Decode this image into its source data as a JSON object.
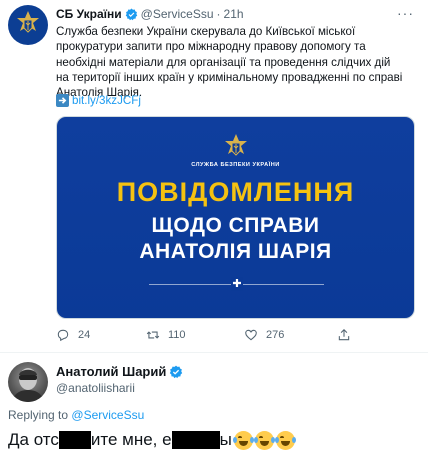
{
  "tweet": {
    "author_name": "СБ України",
    "author_handle": "@ServiceSsu",
    "separator": "·",
    "time": "21h",
    "more": "···",
    "text": "Служба безпеки України скерувала до Київської міської прокуратури запити про міжнародну правову допомогу та необхідні матеріали для організації та проведення слідчих дій на території інших країн у кримінальному провадженні по справі Анатолія Шарія.",
    "link_text": "bit.ly/3kzJCFj",
    "media": {
      "org": "СЛУЖБА БЕЗПЕКИ УКРАЇНИ",
      "title_line1": "ПОВІДОМЛЕННЯ",
      "title_line2": "ЩОДО СПРАВИ",
      "title_line3": "АНАТОЛІЯ ШАРІЯ",
      "colors": {
        "background": "#0b3a97",
        "accent": "#f5c211",
        "text": "#ffffff"
      }
    },
    "actions": {
      "reply_count": "24",
      "retweet_count": "110",
      "like_count": "276"
    }
  },
  "reply": {
    "author_name": "Анатолий Шарий",
    "author_handle": "@anatoliisharii",
    "replying_prefix": "Replying to",
    "replying_to": "@ServiceSsu",
    "text_part1": "Да отс",
    "text_part2": "ите мне, е",
    "text_part3": "ы"
  },
  "colors": {
    "link": "#1d9bf0",
    "secondary_text": "#536471",
    "verified": "#1d9bf0"
  }
}
